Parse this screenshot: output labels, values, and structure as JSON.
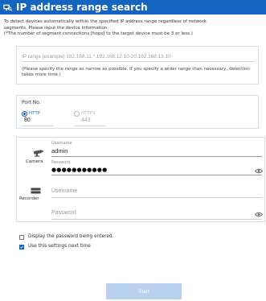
{
  "window": {
    "title": "IP address range search",
    "icon": "network-search-icon",
    "accent": "#1565c0"
  },
  "description": [
    "To detect devices automatically within the specified IP address range  regardless of network",
    "segments. Please input the device information.",
    "(*The number of segment connections [hops] to the target device must be 3 or less.)"
  ],
  "ip_range": {
    "placeholder": "IP range [example] 192.168.11.*,192.168.12.10-20,192.168.13.10",
    "value": "",
    "note": "(Please specify the range as narrow as possible. If you specify a wider range than necessary, detection takes more time.)"
  },
  "port": {
    "title": "Port No.",
    "http": {
      "label": "HTTP",
      "value": "80",
      "checked": true
    },
    "https": {
      "label": "HTTPS",
      "value": "443",
      "checked": false,
      "disabled": true
    }
  },
  "camera": {
    "label": "Camera",
    "icon": "camera-icon",
    "username_label": "Username",
    "username": "admin",
    "password_label": "Password",
    "password_masked": "●●●●●●●●●●●",
    "eye_icon": "eye-icon"
  },
  "recorder": {
    "label": "Recorder",
    "icon": "recorder-icon",
    "username_placeholder": "Username",
    "password_placeholder": "Password",
    "eye_icon": "eye-icon"
  },
  "options": {
    "show_password": {
      "label": "Display the password being entered.",
      "checked": false
    },
    "use_settings": {
      "label": "Use this settings next time",
      "checked": true
    }
  },
  "start_button": "Start"
}
